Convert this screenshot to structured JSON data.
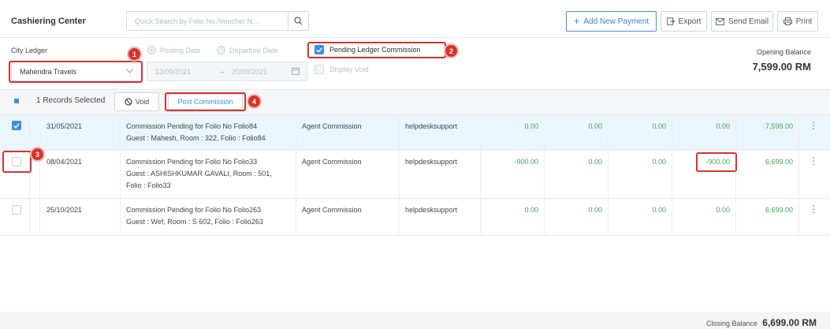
{
  "header": {
    "title": "Cashiering Center",
    "search_placeholder": "Quick Search by Folio No./Voucher N...",
    "add_payment_label": "Add New Payment",
    "export_label": "Export",
    "send_email_label": "Send Email",
    "print_label": "Print",
    "accent_color": "#3a8ee6"
  },
  "filters": {
    "city_ledger_label": "City Ledger",
    "ledger_value": "Mahendra Travels",
    "posting_date_label": "Posting Date",
    "departure_date_label": "Departure Date",
    "date_from": "13/09/2021",
    "date_to": "20/09/2021",
    "pending_commission_label": "Pending Ledger Commission",
    "pending_commission_checked": true,
    "display_void_label": "Display Void",
    "display_void_checked": false,
    "opening_balance_label": "Opening Balance",
    "opening_balance_value": "7,599.00 RM"
  },
  "actions": {
    "records_selected": "1 Records Selected",
    "void_label": "Void",
    "post_commission_label": "Post Commission"
  },
  "rows": [
    {
      "checked": true,
      "date": "31/05/2021",
      "description_line1": "Commission Pending for Folio No Folio84",
      "description_line2": "Guest : Mahesh, Room : 322, Folio : Folio84",
      "description_line3": "",
      "type": "Agent Commission",
      "user": "helpdesksupport",
      "amount1": "0.00",
      "amount2": "0.00",
      "amount3": "0.00",
      "amount4": "0.00",
      "balance": "7,599.00"
    },
    {
      "checked": false,
      "date": "08/04/2021",
      "description_line1": "Commission Pending for Folio No Folio33",
      "description_line2": "Guest : ASHISHKUMAR GAVALI, Room : 501,",
      "description_line3": "Folio : Folio33",
      "type": "Agent Commission",
      "user": "helpdesksupport",
      "amount1": "-900.00",
      "amount2": "0.00",
      "amount3": "0.00",
      "amount4": "-900.00",
      "balance": "6,699.00"
    },
    {
      "checked": false,
      "date": "25/10/2021",
      "description_line1": "Commission Pending for Folio No Folio263",
      "description_line2": "Guest : Wef, Room : S 602, Folio : Folio263",
      "description_line3": "",
      "type": "Agent Commission",
      "user": "helpdesksupport",
      "amount1": "0.00",
      "amount2": "0.00",
      "amount3": "0.00",
      "amount4": "0.00",
      "balance": "6,699.00"
    }
  ],
  "footer": {
    "closing_balance_label": "Closing Balance",
    "closing_balance_value": "6,699.00 RM"
  },
  "annotations": {
    "badge1": "1",
    "badge2": "2",
    "badge3": "3",
    "badge4": "4",
    "highlight_color": "#d9322d"
  }
}
